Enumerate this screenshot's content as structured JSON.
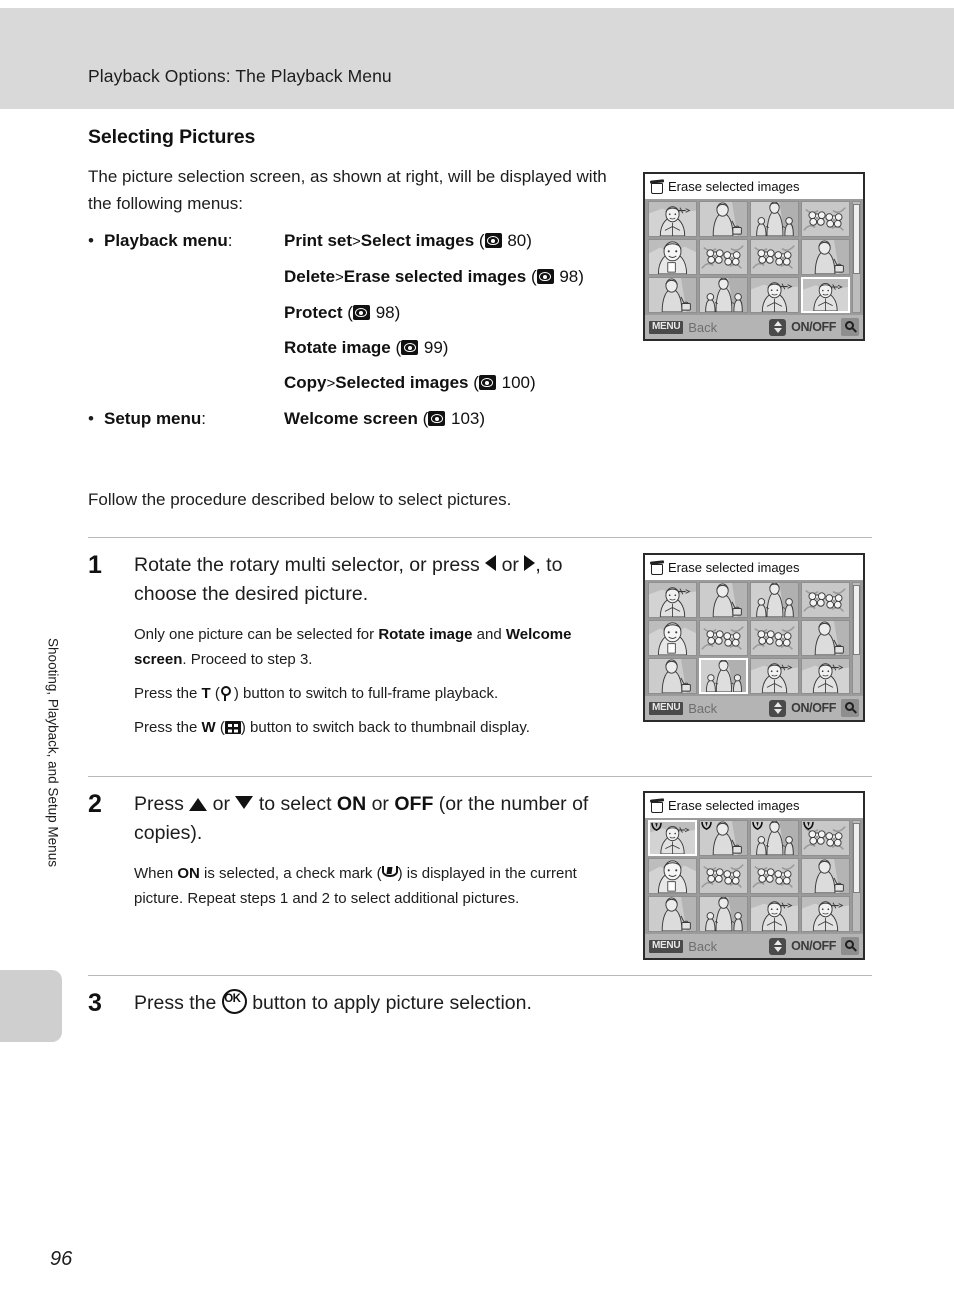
{
  "header": {
    "title": "Playback Options: The Playback Menu"
  },
  "side_tab": {
    "text": "Shooting, Playback, and Setup Menus"
  },
  "footer": {
    "page_number": "96"
  },
  "section": {
    "title": "Selecting Pictures",
    "intro": "The picture selection screen, as shown at right, will be displayed with the following menus:",
    "follow_text": "Follow the procedure described below to select pictures."
  },
  "menu_list": [
    {
      "bullet": "•",
      "label": "Playback menu",
      "label_suffix": ":",
      "entries": [
        {
          "name": "Print set",
          "sep": ">",
          "target": "Select images",
          "ref_icon": "page-ref-icon",
          "page": "80"
        },
        {
          "name": "Delete",
          "sep": ">",
          "target": "Erase selected images",
          "ref_icon": "page-ref-icon",
          "page": "98"
        },
        {
          "name": "Protect",
          "sep": "",
          "target": "",
          "ref_icon": "page-ref-icon",
          "page": "98"
        },
        {
          "name": "Rotate image",
          "sep": "",
          "target": "",
          "ref_icon": "page-ref-icon",
          "page": "99"
        },
        {
          "name": "Copy",
          "sep": ">",
          "target": "Selected images",
          "ref_icon": "page-ref-icon",
          "page": "100"
        }
      ]
    },
    {
      "bullet": "•",
      "label": "Setup menu",
      "label_suffix": ":",
      "entries": [
        {
          "name": "Welcome screen",
          "sep": "",
          "target": "",
          "ref_icon": "page-ref-icon",
          "page": "103"
        }
      ]
    }
  ],
  "steps": [
    {
      "number": "1",
      "head_a": "Rotate the rotary multi selector, or press ",
      "head_b": " or ",
      "head_c": ", to choose the desired picture.",
      "body": [
        {
          "a": "Only one picture can be selected for ",
          "b": "Rotate image",
          "c": " and ",
          "d": "Welcome screen",
          "e": ". Proceed to step 3."
        },
        {
          "a": "Press the ",
          "b": "T",
          "c": " (",
          "d": "magnifier-icon",
          "e": ") button to switch to full-frame playback."
        },
        {
          "a": "Press the ",
          "b": "W",
          "c": " (",
          "d": "thumbnail-grid-icon",
          "e": ") button to switch back to thumbnail display."
        }
      ]
    },
    {
      "number": "2",
      "head_a": "Press ",
      "head_b": " or ",
      "head_c": " to select ",
      "head_on": "ON",
      "head_d": " or ",
      "head_off": "OFF",
      "head_e": " (or the number of copies).",
      "body": [
        {
          "a": "When ",
          "b": "ON",
          "c": " is selected, a check mark (",
          "d": "check-mark-icon",
          "e": ") is displayed in the current picture. Repeat steps 1 and 2 to select additional pictures."
        }
      ]
    },
    {
      "number": "3",
      "head_a": "Press the ",
      "head_ok": "OK",
      "head_c": " button to apply picture selection."
    }
  ],
  "lcd_screens": [
    {
      "id": "lcd-intro",
      "title": "Erase selected images",
      "trash_icon": "trash-icon",
      "back_badge": "MENU",
      "back_label": "Back",
      "onoff_label": "ON/OFF",
      "updown_icon": "up-down-arrow-icon",
      "zoom_icon": "magnifier-icon",
      "selected_index": 11,
      "checked_indexes": [],
      "thumbs": [
        "portrait-plane",
        "woman-bag",
        "family-three",
        "flowers",
        "portrait-face",
        "flowers",
        "flowers",
        "woman-bag",
        "woman-bag",
        "family-three",
        "portrait-plane",
        "portrait-plane"
      ]
    },
    {
      "id": "lcd-step1",
      "title": "Erase selected images",
      "trash_icon": "trash-icon",
      "back_badge": "MENU",
      "back_label": "Back",
      "onoff_label": "ON/OFF",
      "updown_icon": "up-down-arrow-icon",
      "zoom_icon": "magnifier-icon",
      "selected_index": 9,
      "checked_indexes": [],
      "thumbs": [
        "portrait-plane",
        "woman-bag",
        "family-three",
        "flowers",
        "portrait-face",
        "flowers",
        "flowers",
        "woman-bag",
        "woman-bag",
        "family-three",
        "portrait-plane",
        "portrait-plane"
      ]
    },
    {
      "id": "lcd-step2",
      "title": "Erase selected images",
      "trash_icon": "trash-icon",
      "back_badge": "MENU",
      "back_label": "Back",
      "onoff_label": "ON/OFF",
      "updown_icon": "up-down-arrow-icon",
      "zoom_icon": "magnifier-icon",
      "selected_index": 0,
      "checked_indexes": [
        0,
        1,
        2,
        3
      ],
      "thumbs": [
        "portrait-plane",
        "woman-bag",
        "family-three",
        "flowers",
        "portrait-face",
        "flowers",
        "flowers",
        "woman-bag",
        "woman-bag",
        "family-three",
        "portrait-plane",
        "portrait-plane"
      ]
    }
  ]
}
